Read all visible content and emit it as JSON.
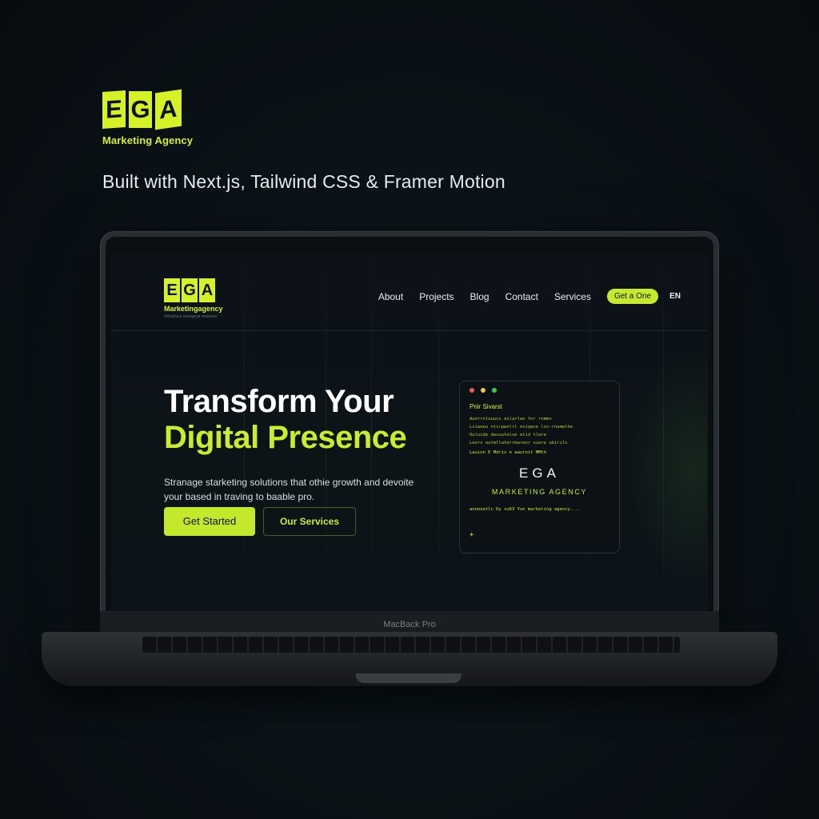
{
  "brand": {
    "logo_letters": [
      "E",
      "G",
      "A"
    ],
    "subtitle": "Marketing Agency",
    "tagline": "Built with Next.js, Tailwind CSS & Framer Motion",
    "accent_color": "#d6f127"
  },
  "device": {
    "label": "MacBack Pro"
  },
  "site": {
    "logo": {
      "letters": [
        "E",
        "G",
        "A"
      ],
      "subtitle": "Marketingagency",
      "tiny_text": "Zxtrisiluce eouegcye mnoerex"
    },
    "nav": {
      "items": [
        "About",
        "Projects",
        "Blog",
        "Contact",
        "Services"
      ],
      "cta": "Get a One",
      "language": "EN"
    },
    "hero": {
      "title_line1": "Transform Your",
      "title_line2": "Digital Presence",
      "description": "Stranage starketing solutions that othie growth and devoite your based in traving to baable pro.",
      "primary_button": "Get Started",
      "secondary_button": "Our Services"
    },
    "terminal": {
      "window_dots": [
        "#f25b5b",
        "#f2c43d",
        "#3ecf4f"
      ],
      "title": "Pnir Sivarst",
      "lines": [
        "Aunrrnlouucs aslarlan for rnmmn",
        "Lsiaeeu ntirpwnlrl eviqace lsv-rnamethe",
        "Ouluide dasuutelse atid tlere",
        "Leorx outmltaterrmareor suore ubirits"
      ],
      "line_after": "Lauion E Mdris e aauroit MMth",
      "ega": "EGA",
      "agency": "MARKETING AGENCY",
      "footer_line": "aoneoatlc Dy su63 Yun marketing agency....",
      "prompt": "+"
    }
  }
}
